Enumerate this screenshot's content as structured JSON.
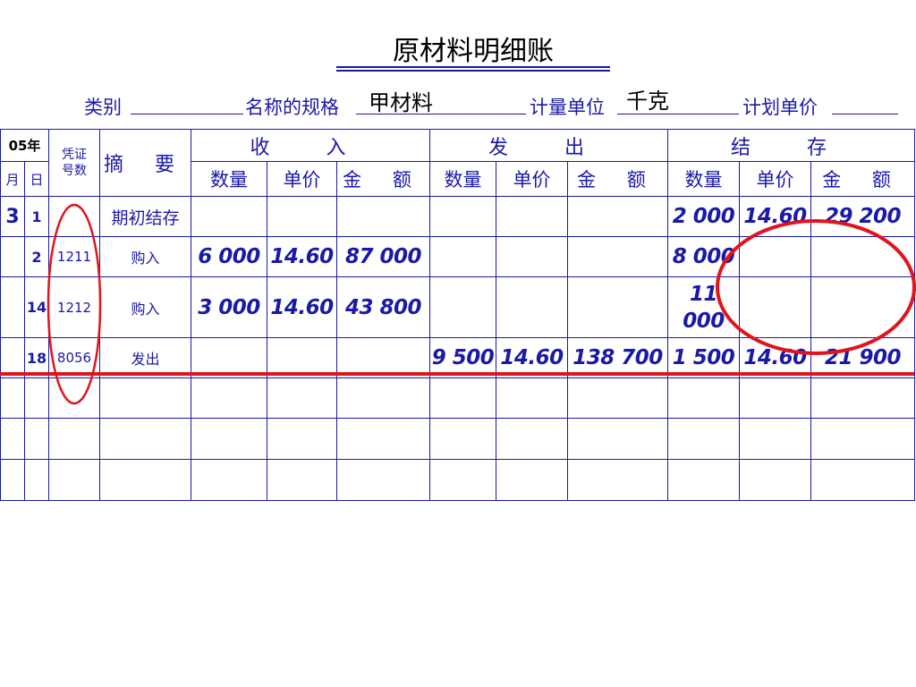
{
  "title": "原材料明细账",
  "meta": {
    "category_label": "类别",
    "name_label": "名称的规格",
    "name_value": "甲材料",
    "unit_label": "计量单位",
    "unit_value": "千克",
    "plan_price_label": "计划单价"
  },
  "headers": {
    "year": "05年",
    "month": "月",
    "day": "日",
    "voucher": "凭证号数",
    "summary": "摘 要",
    "receipt": "收 入",
    "issue": "发 出",
    "balance": "结 存",
    "quantity": "数量",
    "unit_price": "单价",
    "amount": "金 额"
  },
  "rows": [
    {
      "month": "3",
      "day": "1",
      "voucher": "",
      "summary": "期初结存",
      "in_qty": "",
      "in_price": "",
      "in_amt": "",
      "out_qty": "",
      "out_price": "",
      "out_amt": "",
      "bal_qty": "2 000",
      "bal_price": "14.60",
      "bal_amt": "29 200"
    },
    {
      "month": "",
      "day": "2",
      "voucher": "1211",
      "summary": "购入",
      "in_qty": "6 000",
      "in_price": "14.60",
      "in_amt": "87 000",
      "out_qty": "",
      "out_price": "",
      "out_amt": "",
      "bal_qty": "8 000",
      "bal_price": "",
      "bal_amt": ""
    },
    {
      "month": "",
      "day": "14",
      "voucher": "1212",
      "summary": "购入",
      "in_qty": "3 000",
      "in_price": "14.60",
      "in_amt": "43 800",
      "out_qty": "",
      "out_price": "",
      "out_amt": "",
      "bal_qty": "11 000",
      "bal_price": "",
      "bal_amt": ""
    },
    {
      "month": "",
      "day": "18",
      "voucher": "8056",
      "summary": "发出",
      "in_qty": "",
      "in_price": "",
      "in_amt": "",
      "out_qty": "9 500",
      "out_price": "14.60",
      "out_amt": "138 700",
      "bal_qty": "1 500",
      "bal_price": "14.60",
      "bal_amt": "21 900"
    }
  ],
  "colors": {
    "ink": "#1a1aa6",
    "annotation_red": "#e0141e",
    "text_black": "#000000"
  }
}
